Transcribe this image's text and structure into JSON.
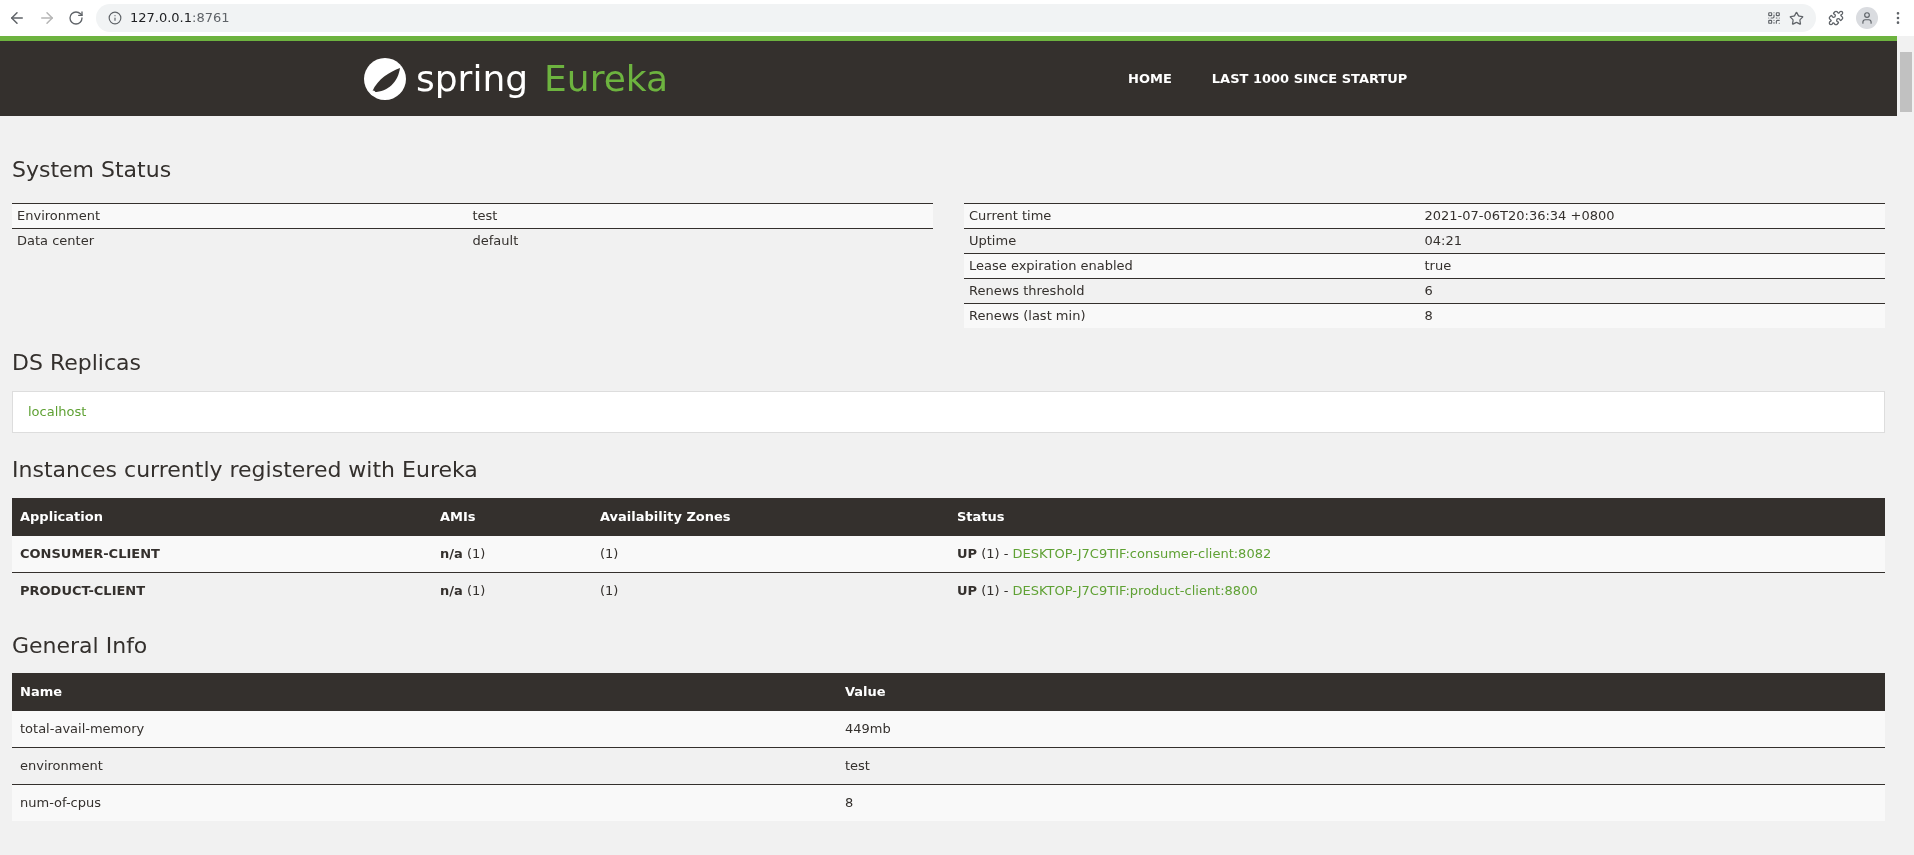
{
  "browser": {
    "host": "127.0.0.1",
    "port": ":8761"
  },
  "header": {
    "logo_word": "spring",
    "logo_product": "Eureka",
    "nav": [
      {
        "label": "HOME"
      },
      {
        "label": "LAST 1000 SINCE STARTUP"
      }
    ]
  },
  "system_status": {
    "title": "System Status",
    "left": [
      {
        "label": "Environment",
        "value": "test"
      },
      {
        "label": "Data center",
        "value": "default"
      }
    ],
    "right": [
      {
        "label": "Current time",
        "value": "2021-07-06T20:36:34 +0800"
      },
      {
        "label": "Uptime",
        "value": "04:21"
      },
      {
        "label": "Lease expiration enabled",
        "value": "true"
      },
      {
        "label": "Renews threshold",
        "value": "6"
      },
      {
        "label": "Renews (last min)",
        "value": "8"
      }
    ]
  },
  "ds_replicas": {
    "title": "DS Replicas",
    "items": [
      "localhost"
    ]
  },
  "instances": {
    "title": "Instances currently registered with Eureka",
    "columns": [
      "Application",
      "AMIs",
      "Availability Zones",
      "Status"
    ],
    "rows": [
      {
        "application": "CONSUMER-CLIENT",
        "amis": "**n/a** (1)",
        "zones": "(1)",
        "status": "**UP** (1) - ",
        "link": "DESKTOP-J7C9TIF:consumer-client:8082"
      },
      {
        "application": "PRODUCT-CLIENT",
        "amis": "**n/a** (1)",
        "zones": "(1)",
        "status": "**UP** (1) - ",
        "link": "DESKTOP-J7C9TIF:product-client:8800"
      }
    ]
  },
  "general_info": {
    "title": "General Info",
    "columns": [
      "Name",
      "Value"
    ],
    "rows": [
      {
        "name": "total-avail-memory",
        "value": "449mb"
      },
      {
        "name": "environment",
        "value": "test"
      },
      {
        "name": "num-of-cpus",
        "value": "8"
      }
    ]
  }
}
